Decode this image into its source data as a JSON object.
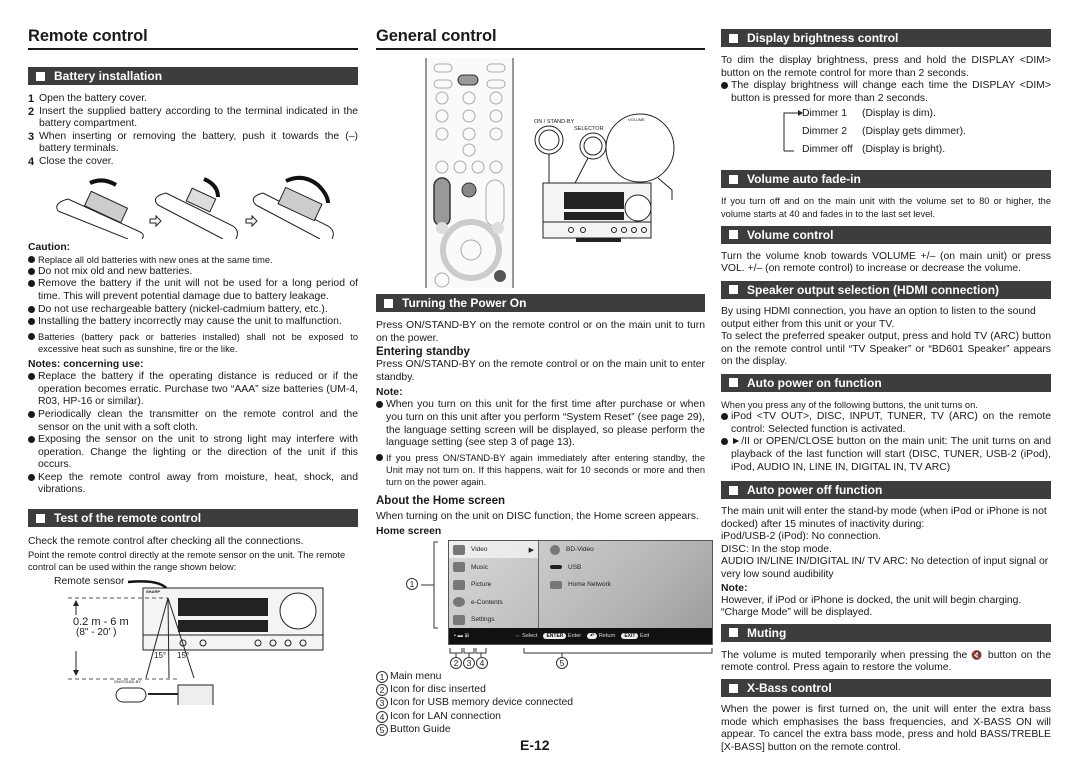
{
  "page_number": "E-12",
  "remote_control": {
    "heading": "Remote control",
    "battery_installation": {
      "title": "Battery installation",
      "steps": [
        {
          "num": "1",
          "text": "Open the battery cover."
        },
        {
          "num": "2",
          "text": "Insert the supplied battery according to the terminal indicated in the battery compartment."
        },
        {
          "num": "3",
          "text": "When inserting or removing the battery, push it towards the (–) battery terminals."
        },
        {
          "num": "4",
          "text": "Close the cover."
        }
      ],
      "caution_label": "Caution:",
      "cautions": [
        "Replace all old batteries with new ones at the same time.",
        "Do not mix old and new batteries.",
        "Remove the battery if the unit will not be used for a long period of time. This will prevent potential damage due to battery leakage.",
        "Do not use rechargeable battery (nickel-cadmium battery, etc.).",
        "Installing the battery incorrectly may cause the unit to malfunction.",
        "Batteries (battery pack or batteries installed) shall not be exposed to excessive heat such as sunshine, fire or the like."
      ],
      "notes_label": "Notes: concerning use:",
      "notes": [
        "Replace the battery if the operating distance is reduced or if the operation becomes erratic. Purchase two “AAA” size batteries (UM-4, R03, HP-16 or similar).",
        "Periodically clean the transmitter on the remote control and the sensor on the unit with a soft cloth.",
        "Exposing the sensor on the unit to strong light may interfere with operation. Change the lighting or the direction of the unit if this occurs.",
        "Keep the remote control away from moisture, heat, shock, and vibrations."
      ]
    },
    "test": {
      "title": "Test of the remote control",
      "line1": "Check the remote control after checking all the connections.",
      "line2": "Point the remote control directly at the remote sensor on the unit. The remote control can be used within the range shown below:",
      "illus": {
        "remote_sensor_label": "Remote sensor",
        "range_metric": "0.2 m - 6 m",
        "range_imperial": "(8\" - 20' )",
        "angle_left": "15°",
        "angle_right": "15°",
        "on_standby_label": "ON/STAND-BY",
        "brand": "SHARP"
      }
    }
  },
  "general_control": {
    "heading": "General control",
    "illus": {
      "on_standby_label": "ON / STAND-BY",
      "selector_label": "SELECTOR",
      "volume_label": "VOLUME"
    },
    "turning_power_on": {
      "title": "Turning the Power On",
      "text": "Press ON/STAND-BY on the remote control or on the main unit to turn on the power.",
      "standby_heading": "Entering standby",
      "standby_text": "Press ON/STAND-BY on the remote control or on the main unit to enter standby.",
      "note_label": "Note:",
      "notes": [
        "When you turn on this unit for the first time after purchase or when you turn on this unit after you perform “System Reset” (see page 29), the language setting screen will be displayed, so please perform the language setting (see step 3 of page 13).",
        "If you press ON/STAND-BY again immediately after entering standby, the Unit may not turn on. If this happens, wait for 10 seconds or more and then turn on the power again."
      ]
    },
    "home_screen": {
      "heading": "About the Home screen",
      "text": "When turning on the unit on DISC function, the Home screen appears.",
      "label": "Home screen",
      "menu_items": [
        "Video",
        "Music",
        "Picture",
        "e-Contents",
        "Settings"
      ],
      "sub_items": [
        "BD-Video",
        "USB",
        "Home Network"
      ],
      "guide": {
        "select": "Select",
        "enter_key": "ENTER",
        "enter": "Enter",
        "return": "Return",
        "exit_key": "EXIT",
        "exit": "Exit"
      },
      "callouts": [
        "1",
        "2",
        "3",
        "4",
        "5"
      ],
      "legend": [
        {
          "num": "1",
          "text": "Main menu"
        },
        {
          "num": "2",
          "text": "Icon for disc inserted"
        },
        {
          "num": "3",
          "text": "Icon for USB memory device connected"
        },
        {
          "num": "4",
          "text": "Icon for LAN connection"
        },
        {
          "num": "5",
          "text": "Button Guide"
        }
      ]
    }
  },
  "right_column": {
    "display_brightness": {
      "title": "Display brightness control",
      "text": "To dim the display brightness, press and hold the DISPLAY <DIM> button on the remote control for more than 2 seconds.",
      "bullet": "The display brightness will change each time the DISPLAY <DIM> button is pressed for more than 2 seconds.",
      "cycle": [
        {
          "state": "Dimmer 1",
          "desc": "(Display is dim)."
        },
        {
          "state": "Dimmer 2",
          "desc": "(Display gets dimmer)."
        },
        {
          "state": "Dimmer off",
          "desc": "(Display is bright)."
        }
      ]
    },
    "volume_fade": {
      "title": "Volume auto fade-in",
      "text": "If you turn off and on the main unit with the volume set to 80 or higher, the volume starts at 40 and fades in to the last set level."
    },
    "volume_control": {
      "title": "Volume control",
      "text": "Turn the volume knob towards VOLUME +/– (on main unit) or press VOL. +/– (on remote control) to increase or decrease the volume."
    },
    "speaker_output": {
      "title": "Speaker output selection (HDMI connection)",
      "text1": "By using HDMI connection, you have an option to listen to the sound output either from this unit or your TV.",
      "text2": "To select the preferred speaker output, press and hold TV (ARC) button on the remote control until “TV Speaker” or “BD601 Speaker” appears on the display."
    },
    "auto_power_on": {
      "title": "Auto power on function",
      "text": "When you press any of the following buttons, the unit turns on.",
      "bullets": [
        "iPod <TV OUT>, DISC, INPUT, TUNER, TV (ARC) on the remote control: Selected function is activated.",
        "►/II or OPEN/CLOSE button on the main unit: The unit turns on and playback of the last function will start (DISC, TUNER, USB-2 (iPod), iPod, AUDIO IN, LINE IN, DIGITAL IN, TV ARC)"
      ]
    },
    "auto_power_off": {
      "title": "Auto power off function",
      "lines": [
        "The main unit will enter the stand-by mode (when iPod or iPhone is not docked) after 15 minutes of inactivity during:",
        "iPod/USB-2 (iPod): No connection.",
        "DISC: In the stop mode.",
        "AUDIO IN/LINE IN/DIGITAL IN/ TV ARC: No detection of input signal or very low sound audibility"
      ],
      "note_label": "Note:",
      "note_lines": [
        "However, if iPod or iPhone is docked, the unit will begin charging.",
        "“Charge Mode” will be displayed."
      ]
    },
    "muting": {
      "title": "Muting",
      "text_before": "The volume is muted temporarily when pressing the",
      "icon": "🔇",
      "text_after": "button on the remote control. Press again to restore the volume."
    },
    "xbass": {
      "title": "X-Bass control",
      "text": "When the power is first turned on, the unit will enter the extra bass mode which emphasises the bass frequencies, and X-BASS ON will appear. To cancel the extra bass mode, press and hold BASS/TREBLE [X-BASS] button on the remote control."
    }
  }
}
